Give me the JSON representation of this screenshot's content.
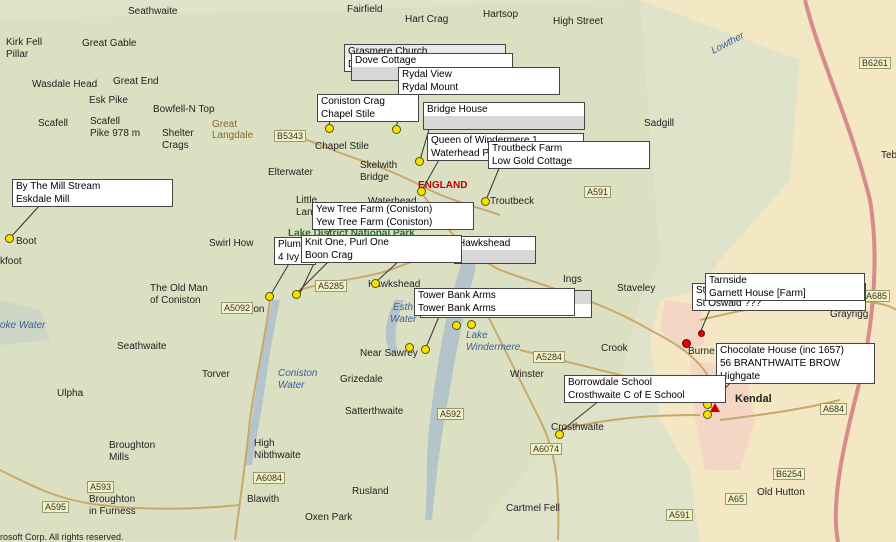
{
  "places": [
    {
      "text": "Seathwaite"
    },
    {
      "text": "Kirk Fell"
    },
    {
      "text": "Pillar"
    },
    {
      "text": "Great Gable"
    },
    {
      "text": "Wasdale Head"
    },
    {
      "text": "Great End"
    },
    {
      "text": "Esk Pike"
    },
    {
      "text": "Bowfell-N Top"
    },
    {
      "text": "Scafell"
    },
    {
      "text": "Scafell"
    },
    {
      "text": "Pike 978 m"
    },
    {
      "text": "Shelter"
    },
    {
      "text": "Crags"
    },
    {
      "text": "Great"
    },
    {
      "text": "Langdale"
    },
    {
      "text": "Fairfield"
    },
    {
      "text": "Hart Crag"
    },
    {
      "text": "Hartsop"
    },
    {
      "text": "High Street"
    },
    {
      "text": "Lowther"
    },
    {
      "text": "Sadgill"
    },
    {
      "text": "Chapel Stile"
    },
    {
      "text": "Elterwater"
    },
    {
      "text": "Skelwith"
    },
    {
      "text": "Bridge"
    },
    {
      "text": "ENGLAND"
    },
    {
      "text": "Troutbeck"
    },
    {
      "text": "Little"
    },
    {
      "text": "Lang"
    },
    {
      "text": "Waterhead"
    },
    {
      "text": "Boot"
    },
    {
      "text": "kfoot"
    },
    {
      "text": "Swirl How"
    },
    {
      "text": "The Old Man"
    },
    {
      "text": "of Coniston"
    },
    {
      "text": "Coniston"
    },
    {
      "text": "Hawkshead"
    },
    {
      "text": "Ings"
    },
    {
      "text": "Staveley"
    },
    {
      "text": "Near Sawrey"
    },
    {
      "text": "Seathwaite"
    },
    {
      "text": "Torver"
    },
    {
      "text": "Grizedale"
    },
    {
      "text": "Winster"
    },
    {
      "text": "Crook"
    },
    {
      "text": "Burne"
    },
    {
      "text": "Kendal"
    },
    {
      "text": "Grayrigg"
    },
    {
      "text": "Ulpha"
    },
    {
      "text": "Satterthwaite"
    },
    {
      "text": "Crosthwaite"
    },
    {
      "text": "Broughton"
    },
    {
      "text": "Mills"
    },
    {
      "text": "High"
    },
    {
      "text": "Nibthwaite"
    },
    {
      "text": "Blawith"
    },
    {
      "text": "Broughton"
    },
    {
      "text": "in Furness"
    },
    {
      "text": "Rusland"
    },
    {
      "text": "Oxen Park"
    },
    {
      "text": "Cartmel Fell"
    },
    {
      "text": "Old Hutton"
    },
    {
      "text": "Teb"
    },
    {
      "text": "Lake District National Park"
    },
    {
      "text": "Coniston"
    },
    {
      "text": "Water"
    },
    {
      "text": "Esth"
    },
    {
      "text": "Water"
    },
    {
      "text": "Lake"
    },
    {
      "text": "Windermere"
    },
    {
      "text": "oke Water"
    }
  ],
  "roads": [
    "A593",
    "A595",
    "A5092",
    "A6084",
    "A5285",
    "A5284",
    "A592",
    "A6074",
    "A591",
    "A685",
    "A684",
    "B6254",
    "A65",
    "B6261",
    "B5343",
    "A591"
  ],
  "callouts": [
    {
      "lines": [
        "Grasmere Church",
        "Dove Cottage"
      ]
    },
    {
      "lines": [
        "Rydal View",
        "Rydal Mount"
      ]
    },
    {
      "lines": [
        "Coniston Crag",
        "Chapel Stile"
      ]
    },
    {
      "lines": [
        "Bridge House",
        ""
      ]
    },
    {
      "lines": [
        "Queen of Windermere 1",
        "Waterhead Pier"
      ]
    },
    {
      "lines": [
        "Troutbeck Farm",
        "Low Gold Cottage"
      ]
    },
    {
      "lines": [
        "By The Mill Stream",
        "Eskdale Mill"
      ]
    },
    {
      "lines": [
        "Yew Tree Farm (Coniston)",
        "Yew Tree Farm (Coniston)"
      ]
    },
    {
      "lines": [
        "Plum",
        "4 Ivy"
      ]
    },
    {
      "lines": [
        "Knit One, Purl One",
        "Boon Crag"
      ]
    },
    {
      "lines": [
        "Hawkshead",
        ""
      ]
    },
    {
      "lines": [
        "Tower Bank Arms",
        "Tower Bank Arms"
      ]
    },
    {
      "lines": [
        "Tarnside",
        "Garnett House [Farm]"
      ]
    },
    {
      "lines": [
        "St",
        "St Oswald ???"
      ]
    },
    {
      "lines": [
        "Chocolate House (inc 1657)",
        "56 BRANTHWAITE BROW",
        "Highgate"
      ]
    },
    {
      "lines": [
        "Borrowdale School",
        "Crosthwaite C of E School"
      ]
    }
  ],
  "copyright": "rosoft Corp. All rights reserved."
}
